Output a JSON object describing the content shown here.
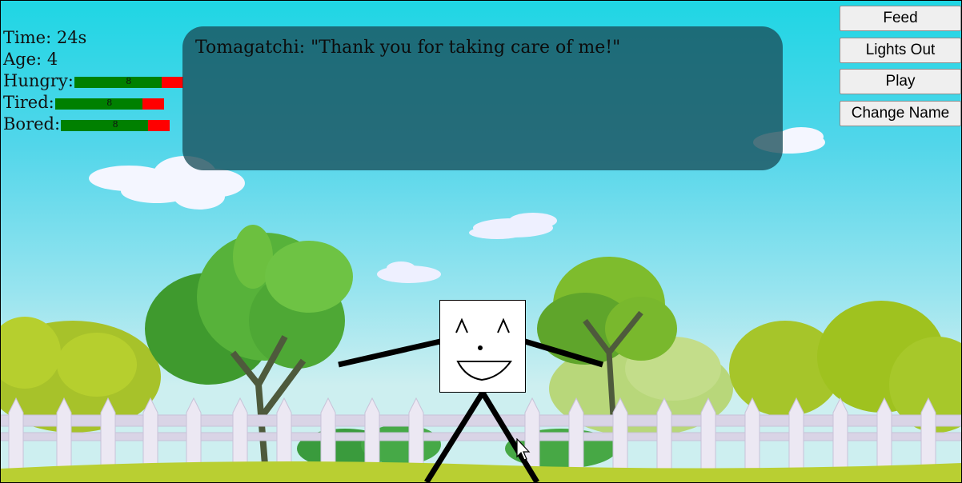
{
  "stats": {
    "time_label": "Time:",
    "time_value": "24s",
    "age_label": "Age:",
    "age_value": "4",
    "hungry_label": "Hungry:",
    "hungry_value": "8",
    "hungry_fill": 0.8,
    "tired_label": "Tired:",
    "tired_value": "8",
    "tired_fill": 0.8,
    "bored_label": "Bored:",
    "bored_value": "8",
    "bored_fill": 0.8
  },
  "message": "Tomagatchi: \"Thank you for taking care of me!\"",
  "buttons": {
    "feed": "Feed",
    "lights_out": "Lights Out",
    "play": "Play",
    "change_name": "Change Name"
  },
  "colors": {
    "sky_top": "#1fd6e4",
    "bar_good": "#008000",
    "bar_bad": "#ff0000",
    "speech_bg": "#194e5a"
  },
  "icons": {
    "pointer": "mouse-pointer-icon"
  }
}
